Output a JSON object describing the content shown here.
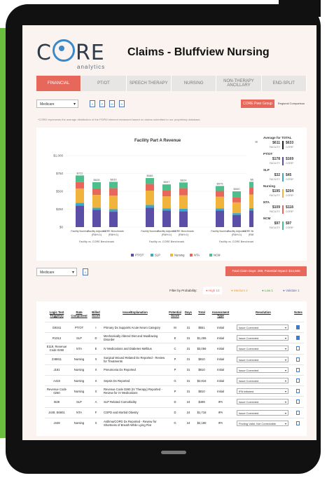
{
  "header": {
    "logo": "CORE",
    "logo_sub": "analytics",
    "title": "Claims - Bluffview Nursing"
  },
  "tabs": [
    {
      "label": "FINANCIAL",
      "active": true
    },
    {
      "label": "PT/OT",
      "active": false
    },
    {
      "label": "SPEECH THERAPY",
      "active": false
    },
    {
      "label": "NURSING",
      "active": false
    },
    {
      "label": "NON-THERAPY ANCILLARY",
      "active": false
    },
    {
      "label": "END-SPLIT",
      "active": false
    }
  ],
  "toolbar": {
    "payer_select": "Medicare",
    "core_peer_group": "CORE Peer Group",
    "regional_comparison": "Regional Comparison"
  },
  "note": "*CORE represents the average distribution of the PDPM element measured based on claims submitted to our proprietary database.",
  "chart_data": {
    "type": "bar",
    "title": "Facility Part A Revenue",
    "y_ticks": [
      "$1,000",
      "$750",
      "$500",
      "$250",
      "$0"
    ],
    "ylim": [
      0,
      1000
    ],
    "categories": [
      "Facility Nominal",
      "Facility Adjusted (RAH=1)",
      "CORE Benchmark (RAH=1)",
      "Facility Nominal",
      "Facility Adjusted (RAH=1)",
      "CORE Benchmark (RAH=1)",
      "Facility Nominal",
      "Facility Adjusted (RAH=1)",
      "CORE Benchmark (RAH=1)"
    ],
    "totals_labels": [
      "$722",
      "$628",
      "$633",
      "$686",
      "$597",
      "$624",
      "$575",
      "$500",
      "$633"
    ],
    "groups": [
      "Facility vs. CORE Benchmark",
      "Facility vs. CORE Benchmark",
      "Facility vs. CORE Benchmark"
    ],
    "series": [
      {
        "name": "PT/OT",
        "color": "#5b4ea6",
        "values": [
          300,
          240,
          215,
          270,
          230,
          220,
          230,
          170,
          230
        ]
      },
      {
        "name": "SLP",
        "color": "#3fa8c8",
        "values": [
          40,
          30,
          35,
          40,
          30,
          35,
          30,
          25,
          35
        ]
      },
      {
        "name": "Nursing",
        "color": "#f0b33c",
        "values": [
          200,
          180,
          190,
          200,
          170,
          190,
          165,
          150,
          190
        ]
      },
      {
        "name": "NTA",
        "color": "#e8675b",
        "values": [
          90,
          90,
          105,
          95,
          80,
          100,
          80,
          75,
          100
        ]
      },
      {
        "name": "NCM",
        "color": "#4cbf8c",
        "values": [
          92,
          88,
          88,
          81,
          87,
          79,
          70,
          80,
          78
        ]
      }
    ]
  },
  "averages": {
    "title": "Average for TOTAL",
    "facility_tag": "FACILITY",
    "core_tag": "CORE*",
    "items": [
      {
        "label": "",
        "facility": "$611",
        "core": "$633",
        "color": "#222222"
      },
      {
        "label": "PT/OT",
        "facility": "$178",
        "core": "$169",
        "color": "#5b4ea6"
      },
      {
        "label": "SLP",
        "facility": "$32",
        "core": "$45",
        "color": "#3fa8c8"
      },
      {
        "label": "Nursing",
        "facility": "$195",
        "core": "$204",
        "color": "#f0b33c"
      },
      {
        "label": "NTA",
        "facility": "$109",
        "core": "$118",
        "color": "#e8675b"
      },
      {
        "label": "NCM",
        "facility": "$97",
        "core": "$97",
        "color": "#4cbf8c"
      }
    ]
  },
  "summary": {
    "payer_select": "Medicare",
    "claim_impact": "Total Claim Days: 289; Potential Impact: $14,505"
  },
  "probability": {
    "label": "Filter by Probability:",
    "high": "High 10",
    "medium": "Medium 2",
    "low": "Low 1",
    "validate": "Validate 1"
  },
  "table": {
    "columns": [
      "Logic Test Trigger(s)",
      "Rate Component",
      "Billed Score",
      "Issue/Explanation",
      "Potential Score",
      "Days",
      "Total",
      "Assessment Type",
      "Resolution",
      "Notes"
    ],
    "rows": [
      [
        "G9341",
        "PT/OT",
        "I",
        "Primary Dx Supports Acute Neuro Category",
        "M",
        "31",
        "$551",
        "Initial",
        "Issue Corrected"
      ],
      [
        "R1312",
        "SLP",
        "D",
        "Mechanically Altered Diet and Swallowing Disorder",
        "E",
        "31",
        "$1,255",
        "Initial",
        "Issue Corrected"
      ],
      [
        "E119, Revenue Code 0260",
        "NTA",
        "E",
        "IV Medications and Diabetes Mellitus",
        "C",
        "31",
        "$3,056",
        "Initial",
        "Issue Corrected"
      ],
      [
        "Z48811",
        "Nursing",
        "X",
        "Surgical Wound Related Dx Reported - Review for Treatments",
        "P",
        "31",
        "$810",
        "Initial",
        "Issue Corrected"
      ],
      [
        "J181",
        "Nursing",
        "X",
        "Pneumonia Dx Reported",
        "P",
        "31",
        "$810",
        "Initial",
        "Issue Corrected"
      ],
      [
        "A419",
        "Nursing",
        "X",
        "Sepsis Dx Reported",
        "G",
        "31",
        "$2,816",
        "Initial",
        "Issue Corrected"
      ],
      [
        "Revenue Code 0260",
        "Nursing",
        "X",
        "Revenue Code 0260 (IV Therapy) Reported - Review for IV Medications",
        "P",
        "31",
        "$810",
        "Initial",
        "IPA Initiated"
      ],
      [
        "I639",
        "SLP",
        "A",
        "SLP Related Comorbidity",
        "D",
        "24",
        "$499",
        "IPA",
        "Issue Corrected"
      ],
      [
        "J449, E6601",
        "NTA",
        "F",
        "COPD and Morbid Obesity",
        "D",
        "24",
        "$1,718",
        "IPA",
        "Issue Corrected"
      ],
      [
        "J449",
        "Nursing",
        "X",
        "Asthma/COPD Dx Reported - Review for Shortness of Breath While Lying Flat",
        "G",
        "24",
        "$2,180",
        "IPA",
        "Finding Valid, Not Correctable"
      ]
    ]
  }
}
